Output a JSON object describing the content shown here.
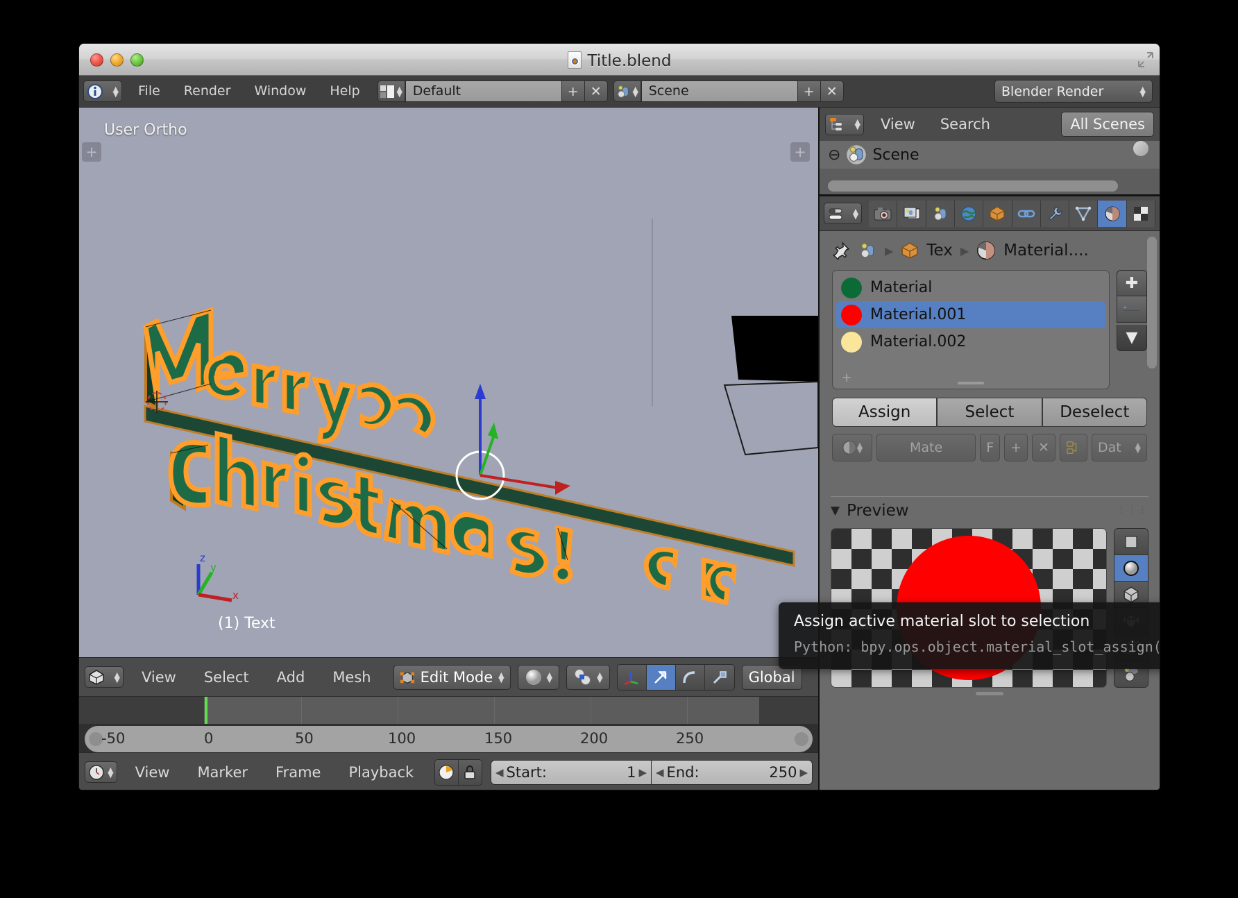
{
  "window": {
    "title": "Title.blend",
    "file_icon": "blend-file-icon",
    "controls": [
      "close",
      "minimize",
      "maximize"
    ]
  },
  "info_bar": {
    "editor_type_icon": "info-editor-icon",
    "menus": [
      "File",
      "Render",
      "Window",
      "Help"
    ],
    "screen_layout": {
      "icon": "screen-layout-icon",
      "value": "Default",
      "add_label": "+",
      "delete_label": "✕"
    },
    "scene": {
      "icon": "scene-icon",
      "value": "Scene",
      "add_label": "+",
      "delete_label": "✕"
    },
    "render_engine": "Blender Render"
  },
  "viewport": {
    "view_label": "User Ortho",
    "object_name": "(1) Text",
    "axis_labels": {
      "x": "x",
      "y": "y",
      "z": "z"
    },
    "artwork_text": "Merry Christmas!",
    "background_color": "#a0a4b4",
    "selection_color": "#ff9e2b",
    "face_color": "#1d6b46"
  },
  "viewport_header": {
    "editor_icon": "3d-view-icon",
    "menus": [
      "View",
      "Select",
      "Add",
      "Mesh"
    ],
    "mode": {
      "icon": "edit-mode-icon",
      "value": "Edit Mode"
    },
    "shading": {
      "icon": "solid-shading-icon"
    },
    "snap_scene": {
      "icon": "pivot-icon"
    },
    "manipulator_buttons": [
      "manipulator-axis-icon",
      "translate-arrow-icon",
      "rotate-arc-icon",
      "scale-icon"
    ],
    "active_manipulator": "translate-arrow-icon",
    "orientation": "Global"
  },
  "timeline": {
    "ticks": [
      "-50",
      "0",
      "50",
      "100",
      "150",
      "200",
      "250"
    ],
    "playhead_frame": 0,
    "playhead_color": "#5ee04a",
    "header": {
      "editor_icon": "timeline-icon",
      "menus": [
        "View",
        "Marker",
        "Frame",
        "Playback"
      ],
      "sync_icon": "sync-icon",
      "lock_icon": "lock-icon",
      "start": {
        "label": "Start:",
        "value": "1"
      },
      "end": {
        "label": "End:",
        "value": "250"
      }
    }
  },
  "outliner": {
    "editor_icon": "outliner-icon",
    "menus": [
      "View",
      "Search"
    ],
    "display_mode": "All Scenes",
    "tree": [
      {
        "expand": "⊖",
        "icon": "scene-icon",
        "label": "Scene"
      }
    ]
  },
  "properties": {
    "editor_icon": "properties-icon",
    "tabs": [
      {
        "name": "render-tab",
        "icon": "camera-icon",
        "active": false
      },
      {
        "name": "render-layers-tab",
        "icon": "images-icon",
        "active": false
      },
      {
        "name": "scene-tab",
        "icon": "scene-icon",
        "active": false
      },
      {
        "name": "world-tab",
        "icon": "world-globe-icon",
        "active": false
      },
      {
        "name": "object-tab",
        "icon": "cube-icon",
        "active": false
      },
      {
        "name": "constraints-tab",
        "icon": "chain-link-icon",
        "active": false
      },
      {
        "name": "modifiers-tab",
        "icon": "wrench-icon",
        "active": false
      },
      {
        "name": "data-tab",
        "icon": "data-triangle-icon",
        "active": false
      },
      {
        "name": "material-tab",
        "icon": "material-sphere-icon",
        "active": true
      },
      {
        "name": "texture-tab",
        "icon": "checker-texture-icon",
        "active": false
      }
    ],
    "breadcrumb": [
      {
        "icon": "pin-icon",
        "label": ""
      },
      {
        "icon": "scene-icon",
        "label": ""
      },
      {
        "icon": "cube-icon",
        "label": "Tex"
      },
      {
        "icon": "material-sphere-icon",
        "label": "Material...."
      }
    ],
    "material_slots": [
      {
        "name": "Material",
        "color": "#0b6b37",
        "selected": false
      },
      {
        "name": "Material.001",
        "color": "#ff0000",
        "selected": true
      },
      {
        "name": "Material.002",
        "color": "#fae59b",
        "selected": false
      }
    ],
    "slot_side_buttons": [
      {
        "name": "add-slot-button",
        "glyph": "✚"
      },
      {
        "name": "remove-slot-button",
        "glyph": "➖"
      },
      {
        "name": "slot-menu-button",
        "glyph": "▼"
      }
    ],
    "action_buttons": [
      {
        "label": "Assign",
        "hover": true
      },
      {
        "label": "Select",
        "hover": false
      },
      {
        "label": "Deselect",
        "hover": false
      }
    ],
    "obscured_row": {
      "material_name": "Mate",
      "fake_user": "F",
      "add_label": "+",
      "unlink_label": "✕",
      "nodes_icon": "nodes-icon",
      "data_label": "Dat"
    },
    "preview": {
      "title": "Preview",
      "collapsed": false,
      "material_color": "#ff0000",
      "types": [
        {
          "name": "preview-type-flat",
          "icon": "flat-plane-icon",
          "active": false
        },
        {
          "name": "preview-type-sphere",
          "icon": "sphere-icon",
          "active": true
        },
        {
          "name": "preview-type-cube",
          "icon": "cube-icon",
          "active": false
        },
        {
          "name": "preview-type-monkey",
          "icon": "monkey-icon",
          "active": false
        },
        {
          "name": "preview-type-hair",
          "icon": "hair-strands-icon",
          "active": false
        },
        {
          "name": "preview-type-sky",
          "icon": "sphere-sky-icon",
          "active": false
        }
      ]
    }
  },
  "tooltip": {
    "title": "Assign active material slot to selection",
    "python": "Python: bpy.ops.object.material_slot_assign()"
  }
}
